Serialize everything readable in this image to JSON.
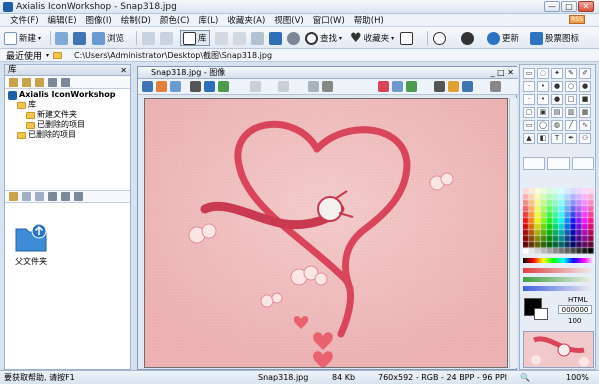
{
  "window": {
    "title": "Axialis IconWorkshop - Snap318.jpg",
    "min": "—",
    "max": "□",
    "close": "✕"
  },
  "menu": [
    "文件(F)",
    "编辑(E)",
    "图像(I)",
    "绘制(D)",
    "颜色(C)",
    "库(L)",
    "收藏夹(A)",
    "视图(V)",
    "窗口(W)",
    "帮助(H)"
  ],
  "rss": "RSS",
  "toolbar": {
    "new": "新建",
    "browse": "浏览",
    "library": "库",
    "find": "查找",
    "favorites": "收藏夹",
    "update": "更新",
    "iconpacks": "股票图标"
  },
  "pathbar": {
    "label": "最近使用",
    "path": "C:\\Users\\Administrator\\Desktop\\截图\\Snap318.jpg"
  },
  "library": {
    "panel_title": "库",
    "close": "✕",
    "tree": {
      "root": "Axialis IconWorkshop",
      "lib": "库",
      "new_folder": "新建文件夹",
      "deleted1": "已删除的项目",
      "deleted2": "已删除的项目"
    },
    "parent_folder": "父文件夹"
  },
  "document": {
    "tab_title": "Snap318.jpg - 图像"
  },
  "right": {
    "html_label": "HTML",
    "hex_value": "000000",
    "alpha": "100",
    "alpha_pct": "100%"
  },
  "status": {
    "help": "要获取帮助, 请按F1",
    "file": "Snap318.jpg",
    "size": "84 Kb",
    "info": "760x592 - RGB - 24 BPP - 96 PPI",
    "zoom": "100%"
  },
  "colors": {
    "accent": "#1f5fa8",
    "canvas_bg": "#eeb8b8",
    "dragon": "#d9465b",
    "heart": "#e8636f"
  }
}
